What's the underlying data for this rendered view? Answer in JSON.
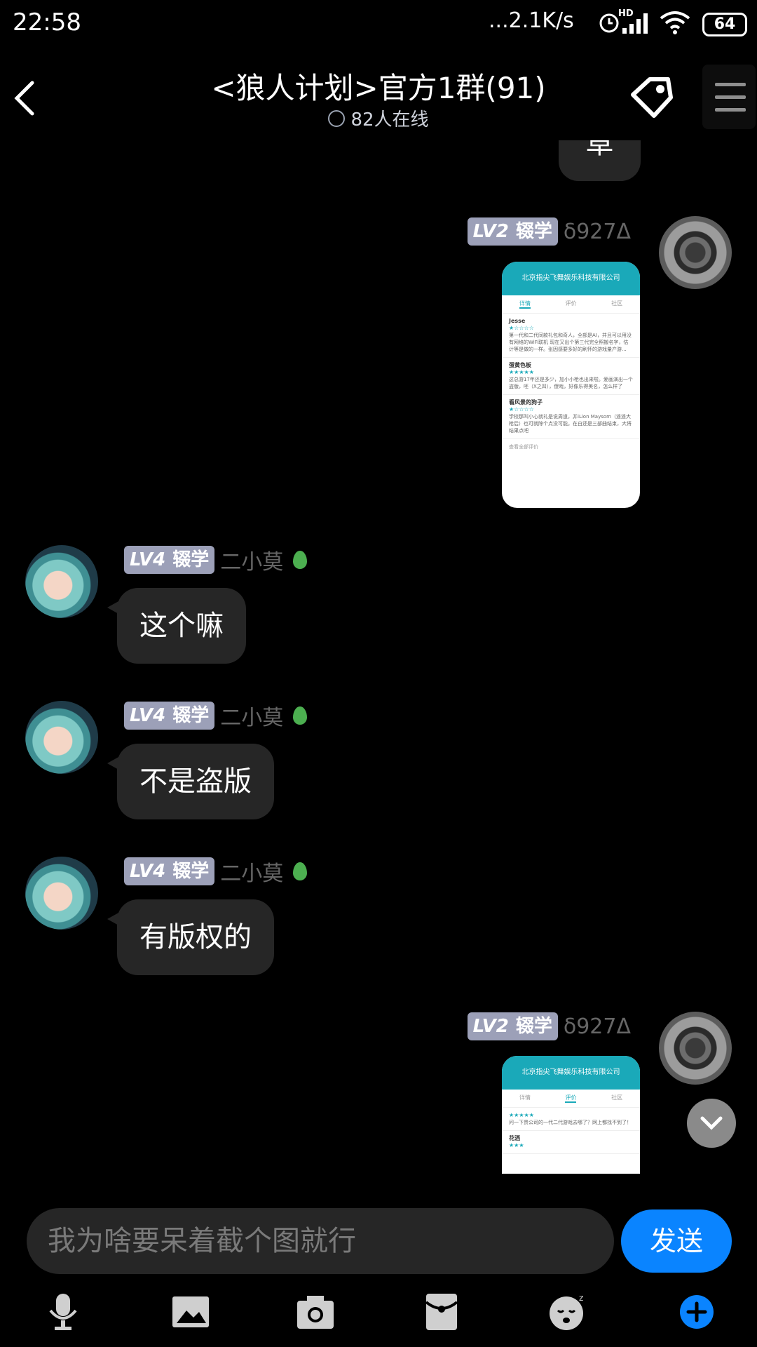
{
  "status_bar": {
    "time": "22:58",
    "network": "...2.1K/s",
    "hd": "HD",
    "battery": "64"
  },
  "header": {
    "title": "<狼人计划>官方1群(91)",
    "online": "82人在线"
  },
  "partial_message": {
    "text": "草"
  },
  "messages": [
    {
      "sender": "δ927Δ",
      "level": "LV2",
      "title": "辍学",
      "type": "image",
      "image": {
        "company": "北京指尖飞舞娱乐科技有限公司",
        "tabs": [
          "详情",
          "评价",
          "社区"
        ],
        "reviews": [
          {
            "user": "Jesse",
            "stars": "★☆☆☆☆",
            "text": "第一代和二代同款礼包和奇人，全部是AI，并且可以用没有网络的WiFi联机 现在又出个第三代完全照搬名字，估计等是做的一样。张因感要多好的刷怀的游戏量产游..."
          },
          {
            "user": "蛋黄色板",
            "stars": "★★★★★",
            "text": "这总游17年还是多少，加小小枪也出来啦。爱画演出一个盗版，呸（X之凹），傻戏，好像乐得美名，怎么样了"
          },
          {
            "user": "看风景的狗子",
            "stars": "★☆☆☆☆",
            "text": "学校那叫小心就礼是说周道，并iLion Maysom（遥遥大枪后）也可就除个点没可能。在白还是三部曲结束，大将结果点吧"
          }
        ],
        "footer": "查看全部评价"
      }
    },
    {
      "sender": "二小莫",
      "level": "LV4",
      "title": "辍学",
      "type": "text",
      "text": "这个嘛"
    },
    {
      "sender": "二小莫",
      "level": "LV4",
      "title": "辍学",
      "type": "text",
      "text": "不是盗版"
    },
    {
      "sender": "二小莫",
      "level": "LV4",
      "title": "辍学",
      "type": "text",
      "text": "有版权的"
    },
    {
      "sender": "δ927Δ",
      "level": "LV2",
      "title": "辍学",
      "type": "image",
      "image": {
        "company": "北京指尖飞舞娱乐科技有限公司",
        "tabs": [
          "详情",
          "评价",
          "社区"
        ],
        "reviews": [
          {
            "user": "",
            "stars": "★★★★★",
            "text": "问一下贵公司的一代二代游戏去哪了？网上都找不到了！"
          },
          {
            "user": "花洒",
            "stars": "★★★",
            "text": ""
          }
        ]
      }
    }
  ],
  "input": {
    "value": "我为啥要呆着截个图就行"
  },
  "send_label": "发送",
  "toolbar": [
    "microphone-icon",
    "image-icon",
    "camera-icon",
    "red-packet-icon",
    "emoji-icon",
    "plus-icon"
  ],
  "colors": {
    "accent": "#0a84ff",
    "badge": "#9ca0b8",
    "bubble": "#262626",
    "thumb_header": "#1aa9b9"
  }
}
